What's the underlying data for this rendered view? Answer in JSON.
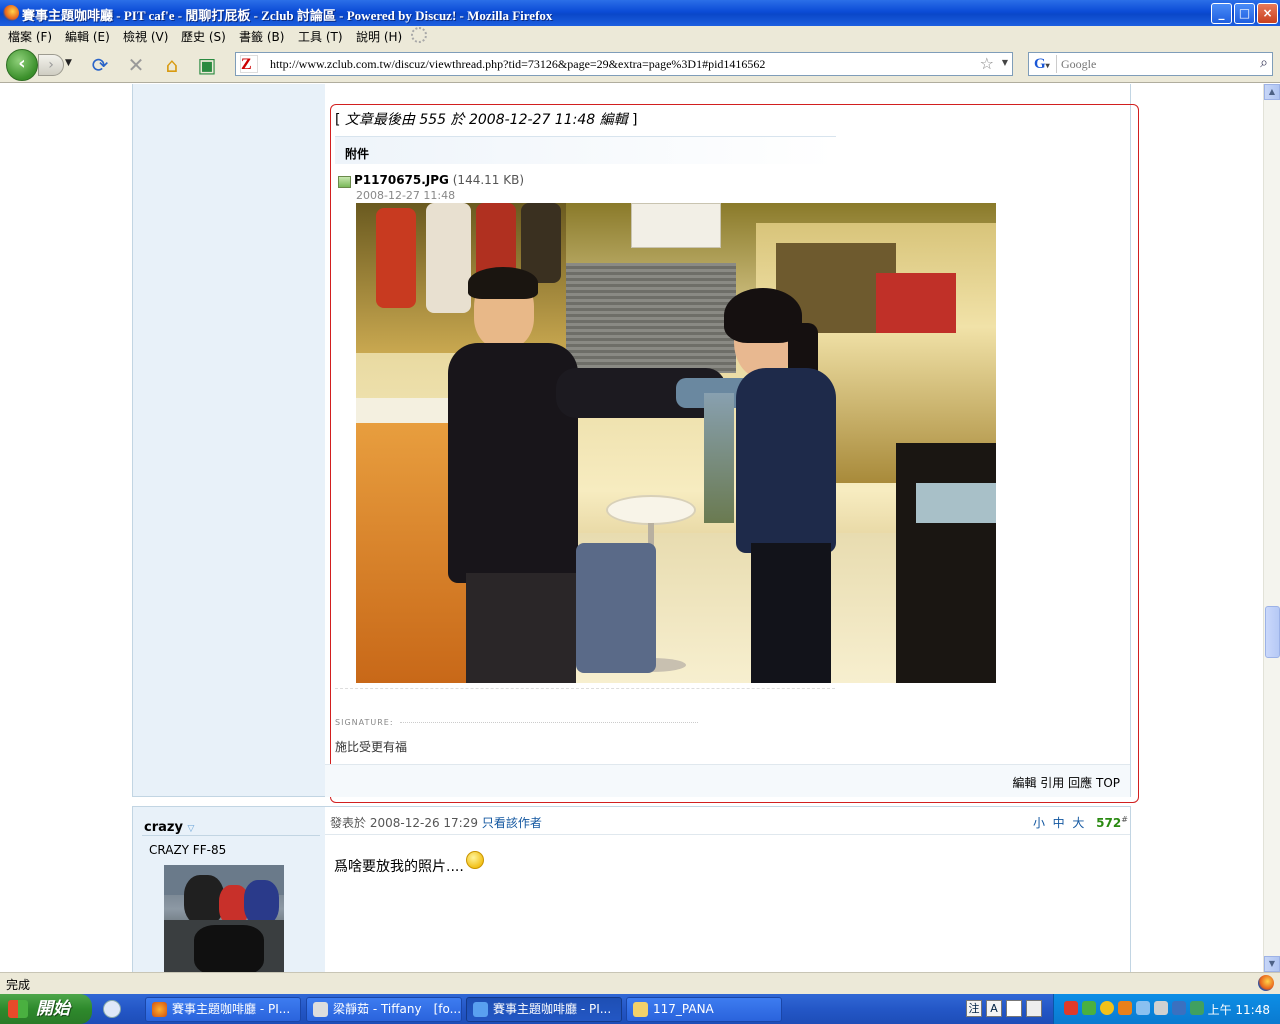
{
  "window": {
    "title": "賽事主題咖啡廳 - PIT caf'e - 閒聊打屁板 - Zclub 討論區 - Powered by Discuz! - Mozilla Firefox",
    "min": "_",
    "max": "□",
    "close": "×"
  },
  "menu": {
    "items": [
      "檔案 (F)",
      "編輯 (E)",
      "檢視 (V)",
      "歷史 (S)",
      "書籤 (B)",
      "工具 (T)",
      "說明 (H)"
    ]
  },
  "toolbar": {
    "url": "http://www.zclub.com.tw/discuz/viewthread.php?tid=73126&page=29&extra=page%3D1#pid1416562",
    "search_placeholder": "Google"
  },
  "post1": {
    "edit_note_prefix": "[ ",
    "edit_note": "文章最後由 555 於 2008-12-27 11:48 編輯",
    "edit_note_suffix": " ]",
    "attachments_label": "附件",
    "file_name": "P1170675.JPG",
    "file_size": "(144.11 KB)",
    "file_date": "2008-12-27 11:48",
    "signature_label": "SIGNATURE:",
    "signature_text": "施比受更有福",
    "actions": [
      "編輯",
      "引用",
      "回應",
      "TOP"
    ]
  },
  "post2": {
    "author": "crazy",
    "nickname": "CRAZY FF-85",
    "posted_label": "發表於",
    "posted_time": "2008-12-26 17:29",
    "only_author": "只看該作者",
    "font_sizes": [
      "小",
      "中",
      "大"
    ],
    "floor": "572",
    "floor_mark": "#",
    "message": "爲啥要放我的照片...."
  },
  "status": {
    "text": "完成"
  },
  "taskbar": {
    "start": "開始",
    "tasks": [
      "賽事主題咖啡廳 - PI...",
      "梁靜茹 - Tiffany　[fo...",
      "賽事主題咖啡廳 - PI...",
      "117_PANA"
    ],
    "clock": "上午 11:48",
    "lang_items": [
      "注",
      "A"
    ]
  },
  "colors": {
    "highlight_border": "#d21f1f",
    "link": "#1357a0",
    "floor": "#2b8a12",
    "side_bg": "#e8f1f9"
  }
}
